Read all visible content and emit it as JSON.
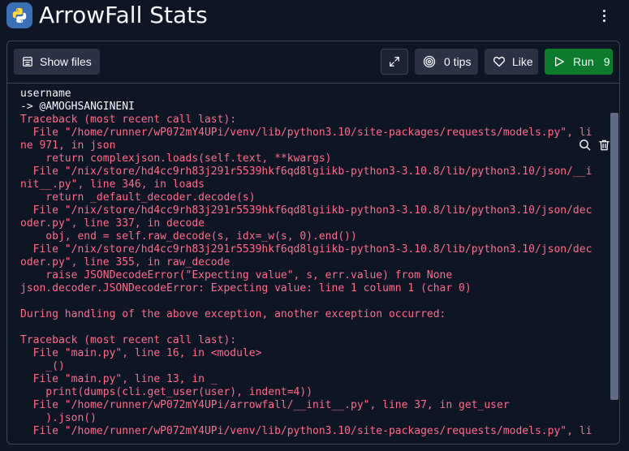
{
  "app": {
    "title": "ArrowFall Stats",
    "logo_icon": "python-icon",
    "accent_color": "#0e7a2e",
    "error_color": "#ff6b8a"
  },
  "toolbar": {
    "show_files_label": "Show files",
    "tips_label": "0 tips",
    "like_label": "Like",
    "run_label": "Run",
    "run_count": "9"
  },
  "console": {
    "lines": [
      {
        "text": "username",
        "kind": "out"
      },
      {
        "text": "-> @AMOGHSANGINENI",
        "kind": "out"
      },
      {
        "text": "Traceback (most recent call last):",
        "kind": "err"
      },
      {
        "text": "  File \"/home/runner/wP072mY4UPi/venv/lib/python3.10/site-packages/requests/models.py\", li",
        "kind": "err"
      },
      {
        "text": "ne 971, in json",
        "kind": "err"
      },
      {
        "text": "    return complexjson.loads(self.text, **kwargs)",
        "kind": "err"
      },
      {
        "text": "  File \"/nix/store/hd4cc9rh83j291r5539hkf6qd8lgiikb-python3-3.10.8/lib/python3.10/json/__i",
        "kind": "err"
      },
      {
        "text": "nit__.py\", line 346, in loads",
        "kind": "err"
      },
      {
        "text": "    return _default_decoder.decode(s)",
        "kind": "err"
      },
      {
        "text": "  File \"/nix/store/hd4cc9rh83j291r5539hkf6qd8lgiikb-python3-3.10.8/lib/python3.10/json/dec",
        "kind": "err"
      },
      {
        "text": "oder.py\", line 337, in decode",
        "kind": "err"
      },
      {
        "text": "    obj, end = self.raw_decode(s, idx=_w(s, 0).end())",
        "kind": "err"
      },
      {
        "text": "  File \"/nix/store/hd4cc9rh83j291r5539hkf6qd8lgiikb-python3-3.10.8/lib/python3.10/json/dec",
        "kind": "err"
      },
      {
        "text": "oder.py\", line 355, in raw_decode",
        "kind": "err"
      },
      {
        "text": "    raise JSONDecodeError(\"Expecting value\", s, err.value) from None",
        "kind": "err"
      },
      {
        "text": "json.decoder.JSONDecodeError: Expecting value: line 1 column 1 (char 0)",
        "kind": "err"
      },
      {
        "text": "",
        "kind": "err"
      },
      {
        "text": "During handling of the above exception, another exception occurred:",
        "kind": "err"
      },
      {
        "text": "",
        "kind": "err"
      },
      {
        "text": "Traceback (most recent call last):",
        "kind": "err"
      },
      {
        "text": "  File \"main.py\", line 16, in <module>",
        "kind": "err"
      },
      {
        "text": "    _()",
        "kind": "err"
      },
      {
        "text": "  File \"main.py\", line 13, in _",
        "kind": "err"
      },
      {
        "text": "    print(dumps(cli.get_user(user), indent=4))",
        "kind": "err"
      },
      {
        "text": "  File \"/home/runner/wP072mY4UPi/arrowfall/__init__.py\", line 37, in get_user",
        "kind": "err"
      },
      {
        "text": "    ).json()",
        "kind": "err"
      },
      {
        "text": "  File \"/home/runner/wP072mY4UPi/venv/lib/python3.10/site-packages/requests/models.py\", li",
        "kind": "err"
      }
    ]
  }
}
